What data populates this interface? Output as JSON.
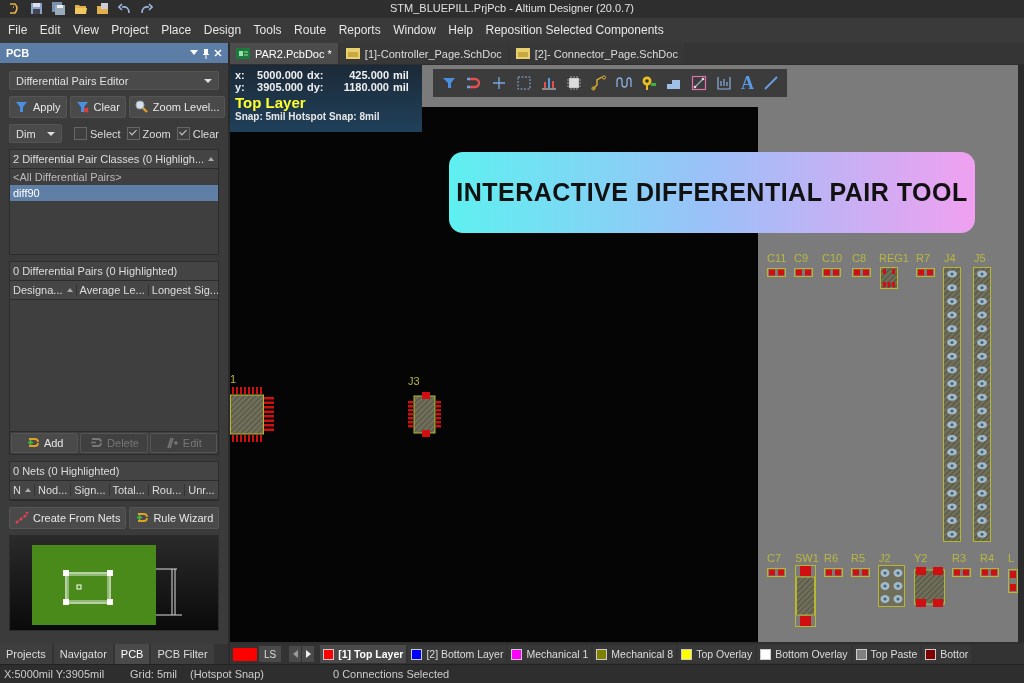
{
  "title_bar": {
    "title": "STM_BLUEPILL.PrjPcb - Altium Designer (20.0.7)"
  },
  "menu": [
    "File",
    "Edit",
    "View",
    "Project",
    "Place",
    "Design",
    "Tools",
    "Route",
    "Reports",
    "Window",
    "Help",
    "Reposition Selected Components"
  ],
  "panel": {
    "title": "PCB",
    "mode": "Differential Pairs Editor",
    "filter_buttons": [
      {
        "kind": "apply",
        "label": "Apply"
      },
      {
        "kind": "clear",
        "label": "Clear"
      },
      {
        "kind": "zoom",
        "label": "Zoom Level..."
      }
    ],
    "highlight_mode": "Dim",
    "options": [
      {
        "label": "Select",
        "checked": false
      },
      {
        "label": "Zoom",
        "checked": true
      },
      {
        "label": "Clear",
        "checked": true
      }
    ],
    "classes": {
      "header": "2 Differential Pair Classes (0 Highligh...",
      "items": [
        {
          "label": "<All Differential Pairs>",
          "selected": false
        },
        {
          "label": "diff90",
          "selected": true
        }
      ]
    },
    "pairs": {
      "header": "0 Differential Pairs (0 Highlighted)",
      "columns": [
        "Designa...",
        "Average Le...",
        "Longest Sig..."
      ]
    },
    "pair_buttons": [
      {
        "kind": "add",
        "label": "Add",
        "disabled": false
      },
      {
        "kind": "delete",
        "label": "Delete",
        "disabled": true
      },
      {
        "kind": "edit",
        "label": "Edit",
        "disabled": true
      }
    ],
    "nets": {
      "header": "0 Nets (0 Highlighted)",
      "columns": [
        "N",
        "Nod...",
        "Sign...",
        "Total...",
        "Rou...",
        "Unr..."
      ]
    },
    "net_buttons": [
      {
        "kind": "nets",
        "label": "Create From Nets"
      },
      {
        "kind": "wizard",
        "label": "Rule Wizard"
      }
    ],
    "tabs": [
      {
        "label": "Projects",
        "selected": false
      },
      {
        "label": "Navigator",
        "selected": false
      },
      {
        "label": "PCB",
        "selected": true
      },
      {
        "label": "PCB Filter",
        "selected": false
      }
    ]
  },
  "document_tabs": [
    {
      "kind": "pcb",
      "label": "PAR2.PcbDoc *",
      "selected": true
    },
    {
      "kind": "sch",
      "label": "[1]-Controller_Page.SchDoc",
      "selected": false
    },
    {
      "kind": "sch",
      "label": "[2]- Connector_Page.SchDoc",
      "selected": false
    }
  ],
  "hud": {
    "rows": [
      [
        "x:",
        "5000.000",
        "dx:",
        "425.000",
        "mil"
      ],
      [
        "y:",
        "3905.000",
        "dy:",
        "1180.000",
        "mil"
      ]
    ],
    "layer": "Top Layer",
    "snap": "Snap: 5mil Hotspot Snap: 8mil"
  },
  "toolbar": [
    {
      "kind": "filter"
    },
    {
      "kind": "magnet"
    },
    {
      "kind": "cross"
    },
    {
      "kind": "select"
    },
    {
      "kind": "chart"
    },
    {
      "kind": "chip"
    },
    {
      "kind": "route"
    },
    {
      "kind": "wave"
    },
    {
      "kind": "pin"
    },
    {
      "kind": "steps"
    },
    {
      "kind": "box"
    },
    {
      "kind": "graph"
    },
    {
      "kind": "text",
      "label": "A"
    },
    {
      "kind": "line"
    }
  ],
  "banner": {
    "text": "INTERACTIVE DIFFERENTIAL PAIR TOOL"
  },
  "components": [
    {
      "designator": "1",
      "kind": "qfp"
    },
    {
      "designator": "J3",
      "kind": "soic"
    },
    {
      "designator": "C11",
      "kind": "chip"
    },
    {
      "designator": "C9",
      "kind": "chip"
    },
    {
      "designator": "C10",
      "kind": "chip"
    },
    {
      "designator": "C8",
      "kind": "chip"
    },
    {
      "designator": "REG1",
      "kind": "reg"
    },
    {
      "designator": "R7",
      "kind": "chip"
    },
    {
      "designator": "J4",
      "kind": "header"
    },
    {
      "designator": "J5",
      "kind": "header"
    },
    {
      "designator": "C7",
      "kind": "chip"
    },
    {
      "designator": "SW1",
      "kind": "switch"
    },
    {
      "designator": "R6",
      "kind": "chip"
    },
    {
      "designator": "R5",
      "kind": "chip"
    },
    {
      "designator": "J2",
      "kind": "pinblock"
    },
    {
      "designator": "Y2",
      "kind": "crystal"
    },
    {
      "designator": "R3",
      "kind": "chip"
    },
    {
      "designator": "R4",
      "kind": "chip"
    },
    {
      "designator": "L",
      "kind": "vchip"
    }
  ],
  "layers": {
    "set": "LS",
    "items": [
      {
        "label": "[1] Top Layer",
        "color": "#ff0000",
        "selected": true
      },
      {
        "label": "[2] Bottom Layer",
        "color": "#0000ff",
        "selected": false
      },
      {
        "label": "Mechanical 1",
        "color": "#ff00ff",
        "selected": false
      },
      {
        "label": "Mechanical 8",
        "color": "#808000",
        "selected": false
      },
      {
        "label": "Top Overlay",
        "color": "#ffff00",
        "selected": false
      },
      {
        "label": "Bottom Overlay",
        "color": "#ffffff",
        "selected": false
      },
      {
        "label": "Top Paste",
        "color": "#808080",
        "selected": false
      },
      {
        "label": "Bottor",
        "color": "#800000",
        "selected": false
      }
    ]
  },
  "status_bar": {
    "position": "X:5000mil Y:3905mil",
    "grid": "Grid: 5mil",
    "snap": "(Hotspot Snap)",
    "selection": "0 Connections Selected"
  }
}
